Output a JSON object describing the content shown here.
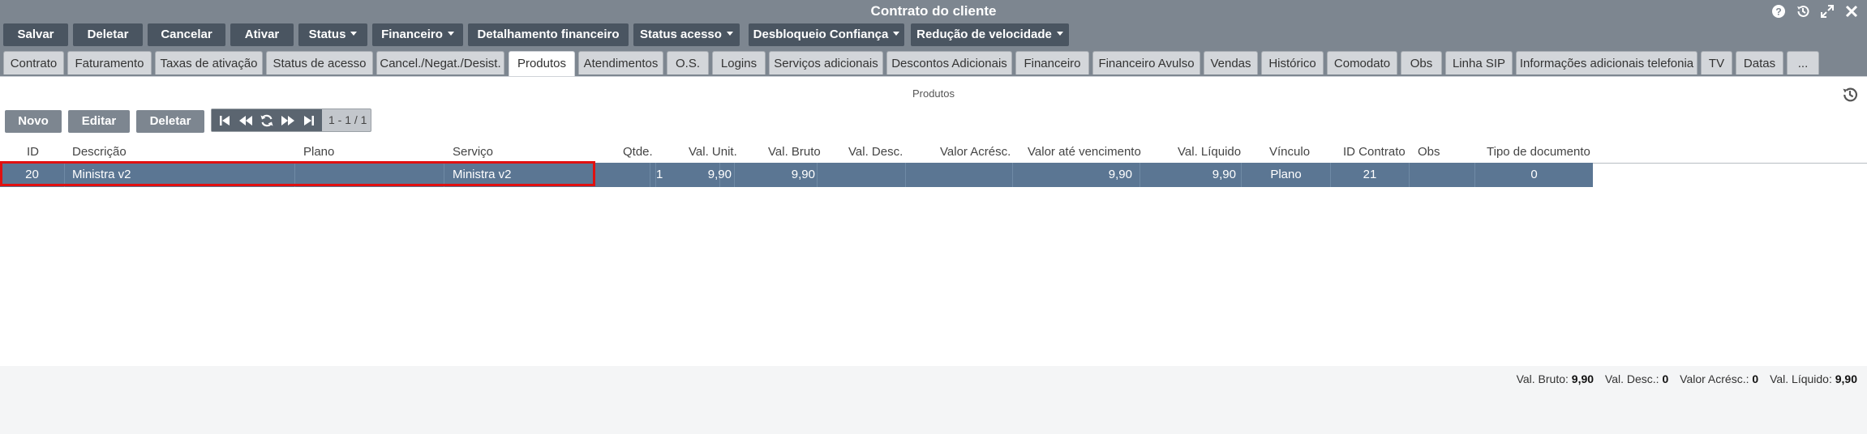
{
  "window": {
    "title": "Contrato do cliente"
  },
  "toolbar": {
    "salvar": "Salvar",
    "deletar": "Deletar",
    "cancelar": "Cancelar",
    "ativar": "Ativar",
    "status": "Status",
    "financeiro": "Financeiro",
    "detalhamento": "Detalhamento financeiro",
    "status_acesso": "Status acesso",
    "desbloqueio": "Desbloqueio Confiança",
    "reducao": "Redução de velocidade"
  },
  "tabs": [
    "Contrato",
    "Faturamento",
    "Taxas de ativação",
    "Status de acesso",
    "Cancel./Negat./Desist.",
    "Produtos",
    "Atendimentos",
    "O.S.",
    "Logins",
    "Serviços adicionais",
    "Descontos Adicionais",
    "Financeiro",
    "Financeiro Avulso",
    "Vendas",
    "Histórico",
    "Comodato",
    "Obs",
    "Linha SIP",
    "Informações adicionais telefonia",
    "TV",
    "Datas",
    "..."
  ],
  "active_tab": "Produtos",
  "section": {
    "title": "Produtos"
  },
  "grid_toolbar": {
    "novo": "Novo",
    "editar": "Editar",
    "deletar": "Deletar",
    "page_info": "1 - 1 / 1"
  },
  "columns": {
    "id": "ID",
    "descricao": "Descrição",
    "plano": "Plano",
    "servico": "Serviço",
    "qtde": "Qtde.",
    "val_unit": "Val. Unit.",
    "val_bruto": "Val. Bruto",
    "val_desc": "Val. Desc.",
    "valor_acresc": "Valor Acrésc.",
    "valor_ate_venc": "Valor até vencimento",
    "val_liquido": "Val. Líquido",
    "vinculo": "Vínculo",
    "id_contrato": "ID Contrato",
    "obs": "Obs",
    "tipo_documento": "Tipo de documento"
  },
  "rows": [
    {
      "id": "20",
      "descricao": "Ministra v2",
      "plano": "",
      "servico": "Ministra v2",
      "qtde": "1",
      "val_unit": "9,90",
      "val_bruto": "9,90",
      "val_desc": "",
      "valor_acresc": "",
      "valor_ate_venc": "9,90",
      "val_liquido": "9,90",
      "vinculo": "Plano",
      "id_contrato": "21",
      "obs": "",
      "tipo_documento": "0"
    }
  ],
  "totals": {
    "val_bruto_label": "Val. Bruto:",
    "val_bruto": "9,90",
    "val_desc_label": "Val. Desc.:",
    "val_desc": "0",
    "valor_acresc_label": "Valor Acrésc.:",
    "valor_acresc": "0",
    "val_liquido_label": "Val. Líquido:",
    "val_liquido": "9,90"
  },
  "colors": {
    "frame": "#7d8690",
    "button_dark": "#4a5561",
    "row_selected": "#5b7693",
    "highlight": "#e01010"
  }
}
